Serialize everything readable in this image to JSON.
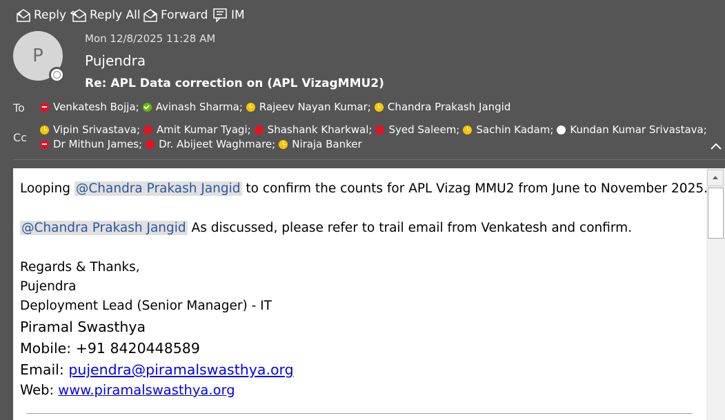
{
  "toolbar": {
    "reply_label": "Reply",
    "reply_all_label": "Reply All",
    "forward_label": "Forward",
    "im_label": "IM"
  },
  "header": {
    "avatar_initial": "P",
    "date": "Mon 12/8/2025 11:28 AM",
    "sender": "Pujendra",
    "subject": "Re: APL Data correction on (APL VizagMMU2)",
    "to_label": "To",
    "cc_label": "Cc",
    "to": [
      {
        "name": "Venkatesh Bojja;",
        "status": "busy"
      },
      {
        "name": "Avinash Sharma;",
        "status": "available"
      },
      {
        "name": "Rajeev Nayan Kumar;",
        "status": "away"
      },
      {
        "name": "Chandra Prakash Jangid",
        "status": "away"
      }
    ],
    "cc_line1": [
      {
        "name": "Vipin Srivastava;",
        "status": "away"
      },
      {
        "name": "Amit Kumar Tyagi;",
        "status": "dnd"
      },
      {
        "name": "Shashank Kharkwal;",
        "status": "dnd"
      },
      {
        "name": "Syed Saleem;",
        "status": "dnd"
      },
      {
        "name": "Sachin Kadam;",
        "status": "away"
      },
      {
        "name": "Kundan Kumar Srivastava;",
        "status": "offline"
      }
    ],
    "cc_line2": [
      {
        "name": "Dr Mithun James;",
        "status": "busy"
      },
      {
        "name": "Dr. Abijeet Waghmare;",
        "status": "dnd"
      },
      {
        "name": "Niraja Banker",
        "status": "away"
      }
    ]
  },
  "body": {
    "line1_prefix": "Looping ",
    "line1_mention": "@Chandra Prakash Jangid",
    "line1_suffix": " to confirm the counts for APL Vizag MMU2 from June to November 2025.",
    "line2_mention": "@Chandra Prakash Jangid",
    "line2_suffix": " As discussed, please refer to trail email from Venkatesh and confirm.",
    "sig_regards": "Regards & Thanks,",
    "sig_name": "Pujendra",
    "sig_title": "Deployment Lead (Senior Manager) - IT",
    "sig_org": "Piramal Swasthya",
    "sig_mobile": "Mobile: +91 8420448589",
    "sig_email_label": "Email: ",
    "sig_email": "pujendra@piramalswasthya.org",
    "sig_web_label": "Web: ",
    "sig_web": "www.piramalswasthya.org"
  },
  "colors": {
    "header_bg": "#555555",
    "busy": "#e81123",
    "available": "#6bb700",
    "away": "#f8c600",
    "mention_text": "#2b579a",
    "link": "#0000ee"
  }
}
